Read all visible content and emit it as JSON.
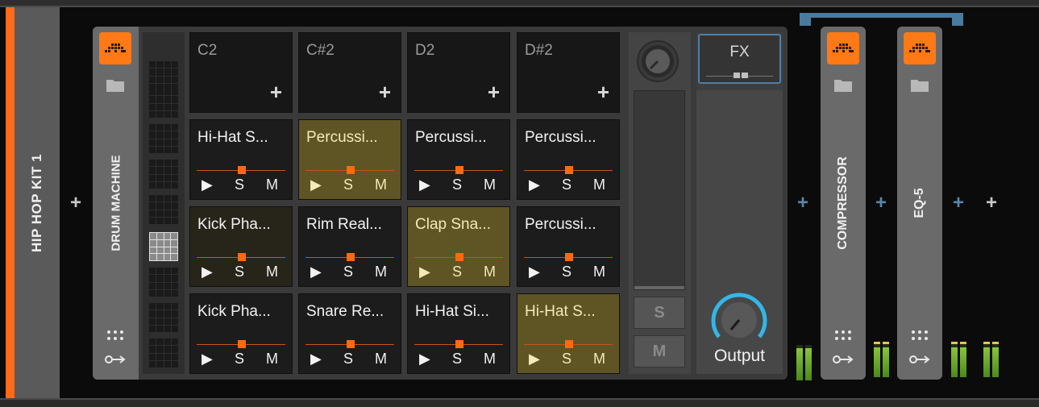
{
  "track": {
    "title": "HIP HOP KIT 1",
    "accent_color": "#ff6a1a"
  },
  "drum_machine": {
    "title": "DRUM MACHINE",
    "pads": [
      {
        "label": "C2",
        "state": "empty"
      },
      {
        "label": "C#2",
        "state": "empty"
      },
      {
        "label": "D2",
        "state": "empty"
      },
      {
        "label": "D#2",
        "state": "empty"
      },
      {
        "label": "Hi-Hat S...",
        "state": "normal"
      },
      {
        "label": "Percussi...",
        "state": "selected"
      },
      {
        "label": "Percussi...",
        "state": "normal"
      },
      {
        "label": "Percussi...",
        "state": "normal"
      },
      {
        "label": "Kick Pha...",
        "state": "selected-dark"
      },
      {
        "label": "Rim Real...",
        "state": "normal"
      },
      {
        "label": "Clap Sna...",
        "state": "selected"
      },
      {
        "label": "Percussi...",
        "state": "normal"
      },
      {
        "label": "Kick Pha...",
        "state": "normal"
      },
      {
        "label": "Snare Re...",
        "state": "normal"
      },
      {
        "label": "Hi-Hat Si...",
        "state": "normal"
      },
      {
        "label": "Hi-Hat S...",
        "state": "selected"
      }
    ],
    "pad_controls": {
      "play": "▶",
      "solo": "S",
      "mute": "M"
    },
    "mixer": {
      "solo": "S",
      "mute": "M"
    },
    "fx_label": "FX",
    "output_label": "Output"
  },
  "devices": [
    {
      "title": "COMPRESSOR"
    },
    {
      "title": "EQ-5"
    }
  ],
  "colors": {
    "orange": "#ff7a16",
    "blue_accent": "#4d7fa6",
    "selected_pad": "#5e5424"
  },
  "icons": {
    "plus": "+",
    "preset": "preset-icon",
    "folder": "folder-icon",
    "dots": "dots-grid-icon",
    "routing": "routing-icon"
  }
}
